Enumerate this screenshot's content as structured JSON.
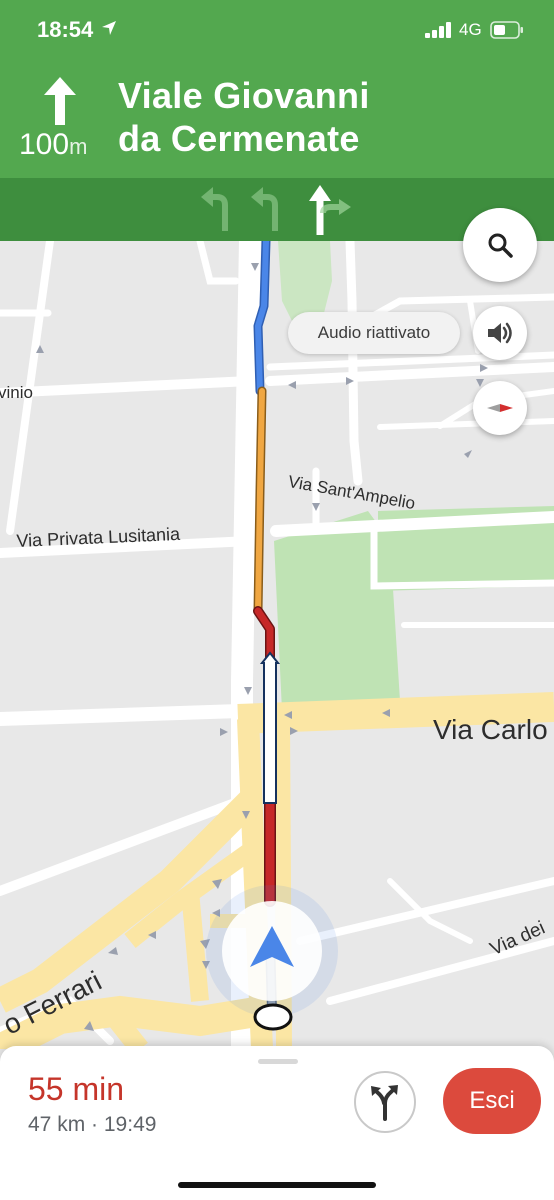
{
  "status_bar": {
    "time": "18:54",
    "network": "4G",
    "icons": [
      "location-arrow-icon",
      "signal-bars-icon",
      "battery-icon"
    ]
  },
  "navigation": {
    "distance_value": "100",
    "distance_unit": "m",
    "street_line_1": "Viale Giovanni",
    "street_line_2": "da Cermenate",
    "turn_icon": "straight-arrow-icon",
    "lanes": [
      "turn-left",
      "turn-left",
      "straight-or-right"
    ],
    "active_lane": 2,
    "colors": {
      "header": "#53a84f",
      "lane_bar": "#3e8e3e"
    }
  },
  "map": {
    "labels": {
      "vinio": "vinio",
      "via_sant_ampelio": "Via Sant'Ampelio",
      "via_privata_lusitania": "Via Privata Lusitania",
      "via_carlo": "Via Carlo",
      "ferrari": "o Ferrari",
      "via_dei": "Via dei"
    },
    "route_colors": {
      "clear": "#4a86e8",
      "slow": "#f0a742",
      "jam": "#c62828"
    }
  },
  "controls": {
    "audio_status": "Audio riattivato",
    "icons": [
      "search-icon",
      "speaker-icon",
      "compass-icon"
    ]
  },
  "trip": {
    "duration": "55 min",
    "distance": "47 km",
    "separator": "·",
    "arrival": "19:49",
    "exit_label": "Esci",
    "alt_routes_icon": "route-fork-icon"
  }
}
